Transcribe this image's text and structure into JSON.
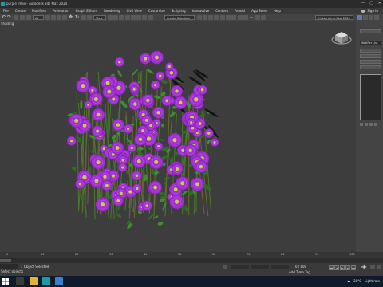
{
  "app": {
    "title": "purple .max - Autodesk 3ds Max 2020",
    "window_controls": [
      "—",
      "▢",
      "✕"
    ],
    "signin": "Sign In"
  },
  "menubar": {
    "items": [
      "File",
      "Create",
      "Modifiers",
      "Animation",
      "Graph Editors",
      "Rendering",
      "Civil View",
      "Customize",
      "Scripting",
      "Interactive",
      "Content",
      "Arnold",
      "App Store",
      "Help"
    ]
  },
  "toolbar": {
    "filter": "All",
    "view": "View",
    "selection_set": "Create Selection Se",
    "workspace": "C:\\Users\\\\...x Max 2020"
  },
  "viewport": {
    "label": "Shading",
    "background": "#3d3d3d"
  },
  "command_panel": {
    "modifier_list": "Modifier List"
  },
  "timeline": {
    "ticks": [
      "0",
      "10",
      "20",
      "30",
      "40",
      "50",
      "60",
      "70",
      "80",
      "90",
      "100"
    ]
  },
  "status": {
    "selection": "1 Object Selected",
    "prompt": "Select objects",
    "add_time_tag": "Add Time Tag",
    "frame": "0 / 100"
  },
  "taskbar": {
    "temperature": "28°C",
    "weather": "Light rain"
  },
  "colors": {
    "flower_petal": "#a030d0",
    "flower_center": "#c8d040",
    "leaf": "#3f8f2f",
    "accent_blue": "#3a7fd0"
  }
}
